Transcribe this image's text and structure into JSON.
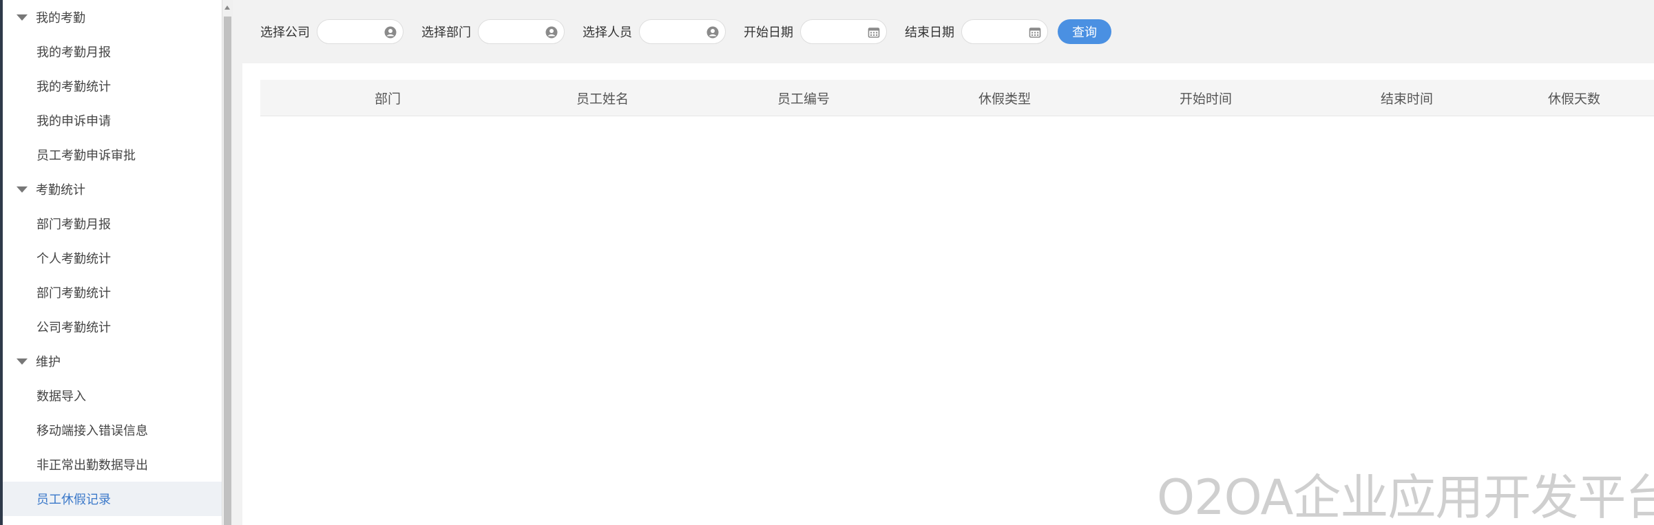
{
  "sidebar": {
    "groups": [
      {
        "label": "我的考勤",
        "items": [
          "我的考勤月报",
          "我的考勤统计",
          "我的申诉申请",
          "员工考勤申诉审批"
        ]
      },
      {
        "label": "考勤统计",
        "items": [
          "部门考勤月报",
          "个人考勤统计",
          "部门考勤统计",
          "公司考勤统计"
        ]
      },
      {
        "label": "维护",
        "items": [
          "数据导入",
          "移动端接入错误信息",
          "非正常出勤数据导出",
          "员工休假记录"
        ]
      }
    ],
    "active_item": "员工休假记录"
  },
  "filters": {
    "company_label": "选择公司",
    "department_label": "选择部门",
    "person_label": "选择人员",
    "start_date_label": "开始日期",
    "end_date_label": "结束日期",
    "query_button": "查询"
  },
  "table": {
    "columns": [
      "部门",
      "员工姓名",
      "员工编号",
      "休假类型",
      "开始时间",
      "结束时间",
      "休假天数"
    ],
    "rows": []
  },
  "watermark": "O2OA企业应用开发平台",
  "colors": {
    "accent": "#4a90e2",
    "active_text": "#3a78c9",
    "active_bg": "#eef1f5"
  }
}
